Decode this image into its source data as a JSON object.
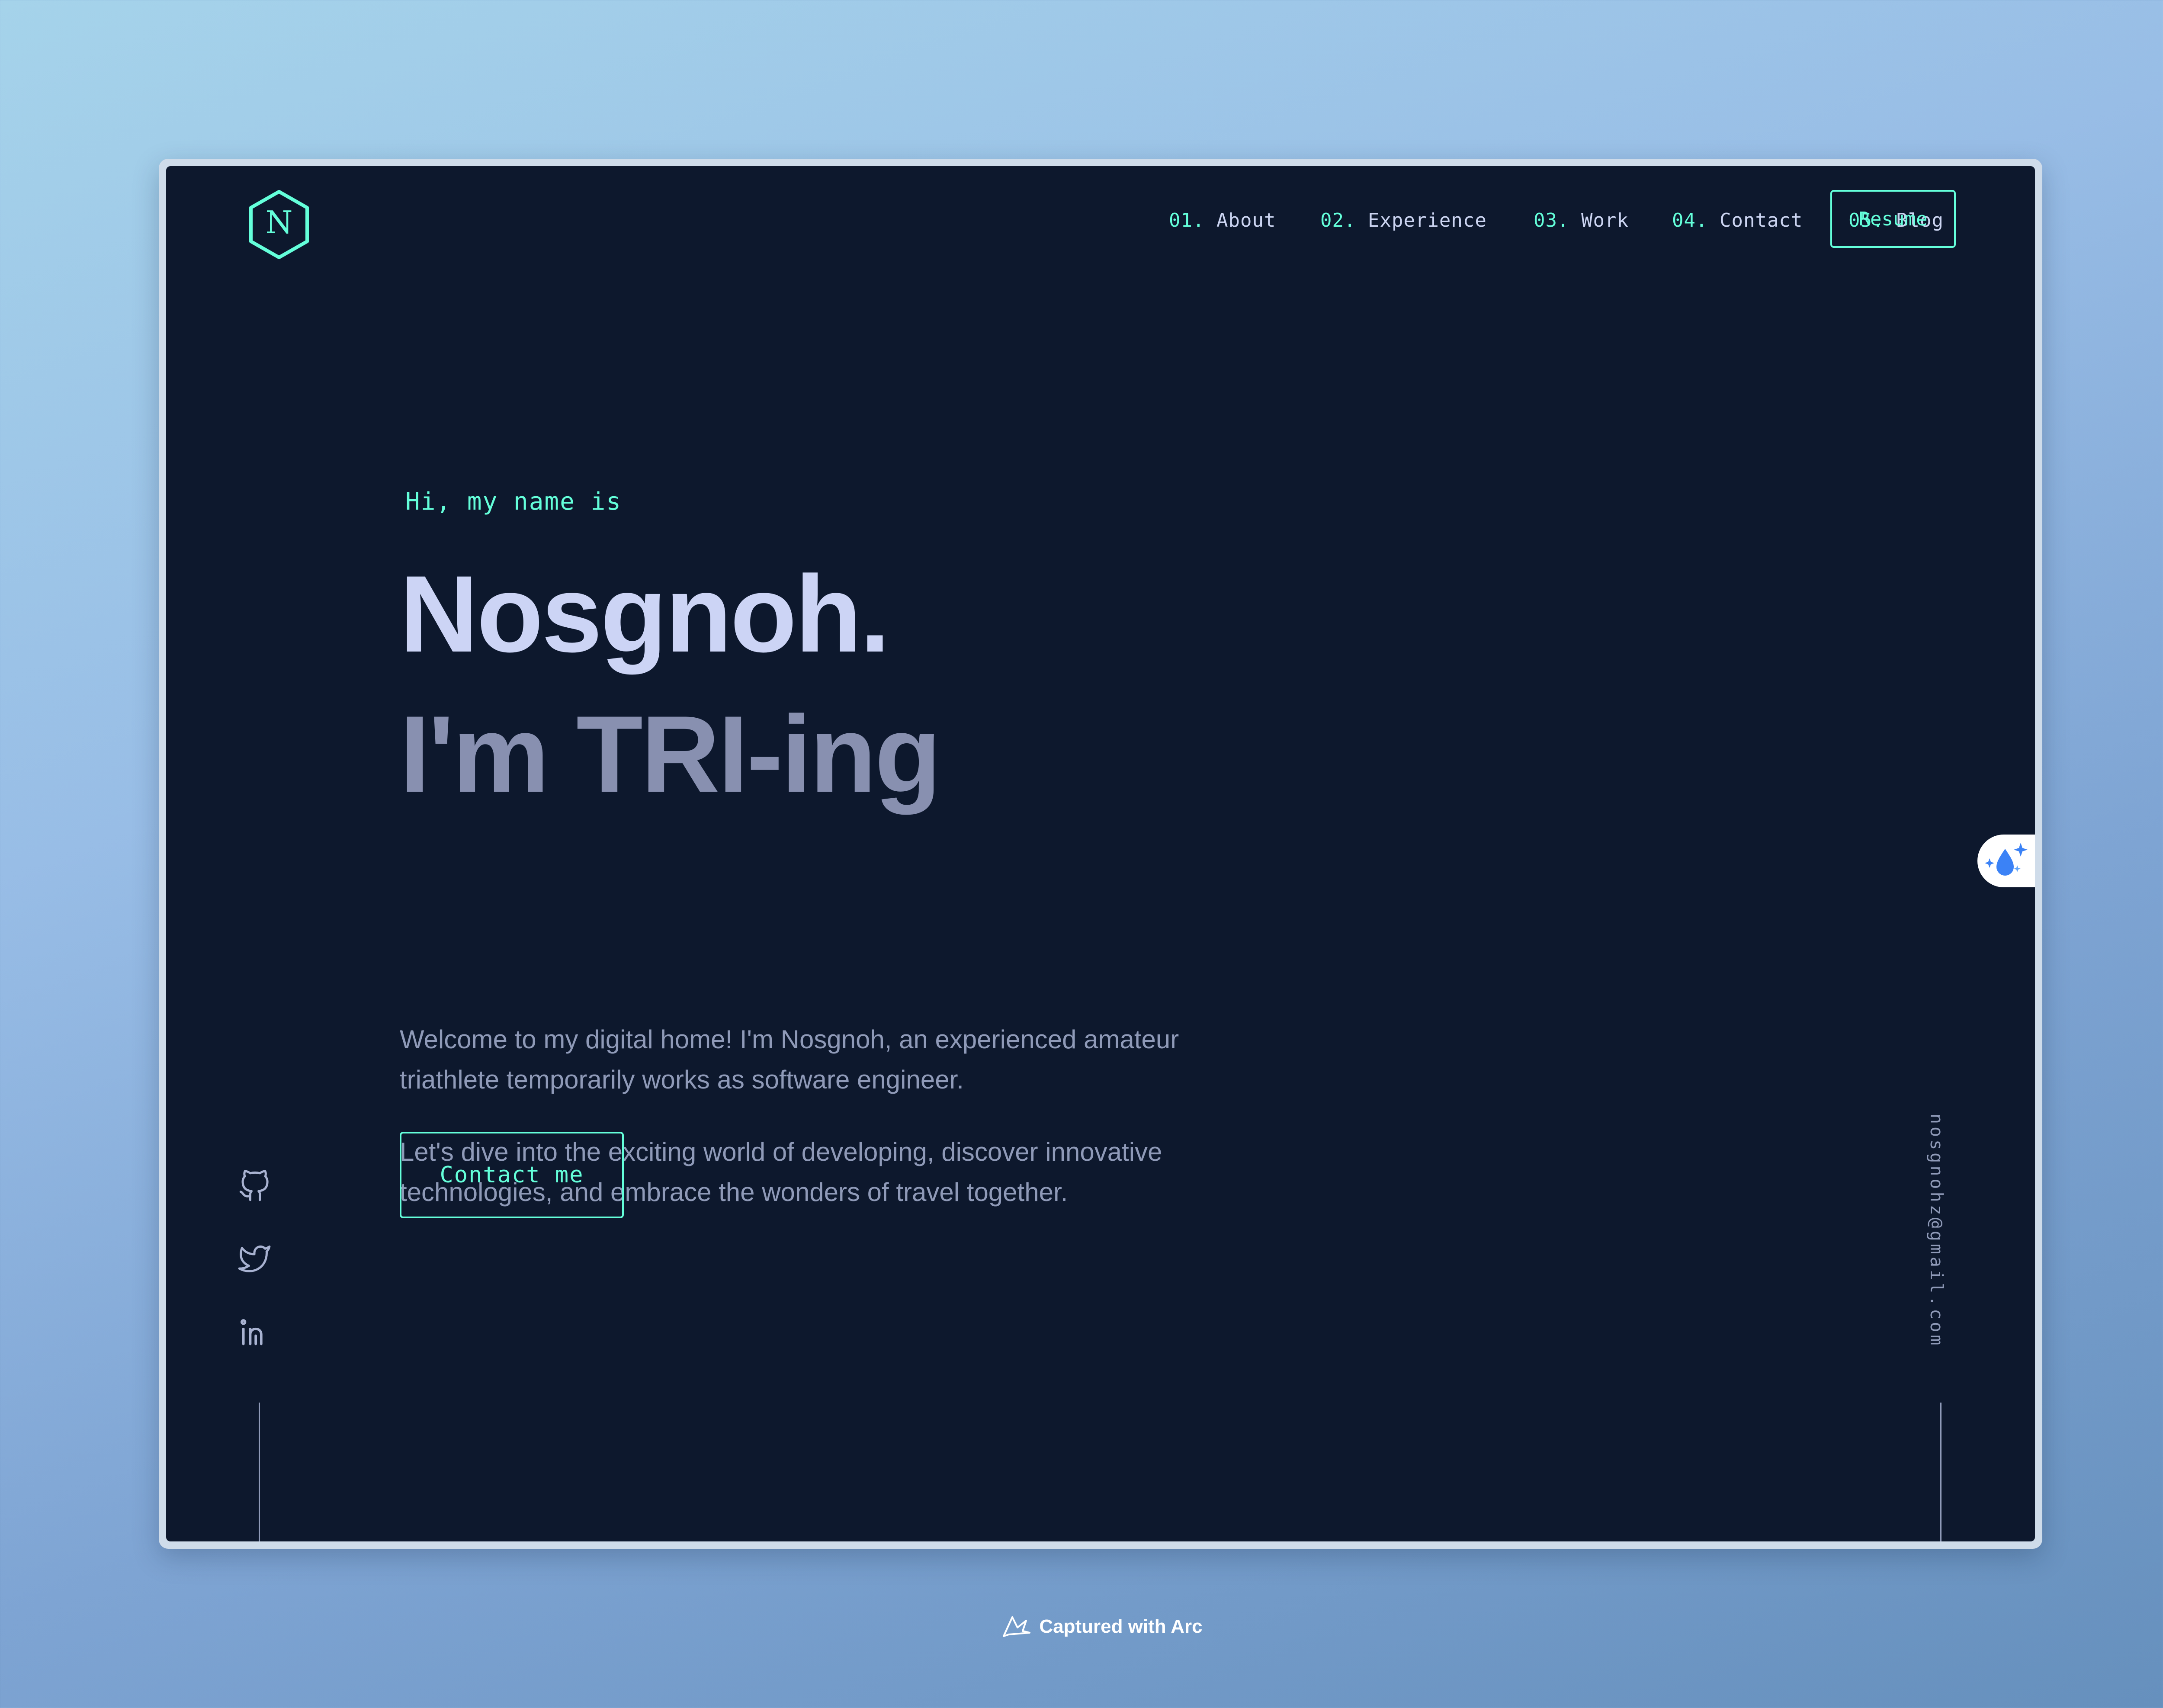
{
  "nav": {
    "items": [
      {
        "num": "01.",
        "label": "About"
      },
      {
        "num": "02.",
        "label": "Experience"
      },
      {
        "num": "03.",
        "label": "Work"
      },
      {
        "num": "04.",
        "label": "Contact"
      },
      {
        "num": "05.",
        "label": "Blog"
      }
    ],
    "resume_label": "Resume",
    "logo_letter": "N"
  },
  "hero": {
    "greeting": "Hi, my name is",
    "name": "Nosgnoh.",
    "tagline": "I'm TRI-ing",
    "paragraphs": [
      "Welcome to my digital home! I'm Nosgnoh, an experienced amateur triathlete temporarily works as software engineer.",
      "Let's dive into the exciting world of developing, discover innovative technologies, and embrace the wonders of travel together."
    ],
    "cta_label": "Contact me"
  },
  "sidebar": {
    "email": "nosgnohz@gmail.com",
    "socials": [
      "github-icon",
      "twitter-icon",
      "linkedin-icon"
    ]
  },
  "footer": {
    "capture_text": "Captured with Arc"
  },
  "colors": {
    "background": "#0d182d",
    "accent": "#64ffda",
    "heading": "#ccd4f5",
    "muted": "#8f9ab8"
  }
}
